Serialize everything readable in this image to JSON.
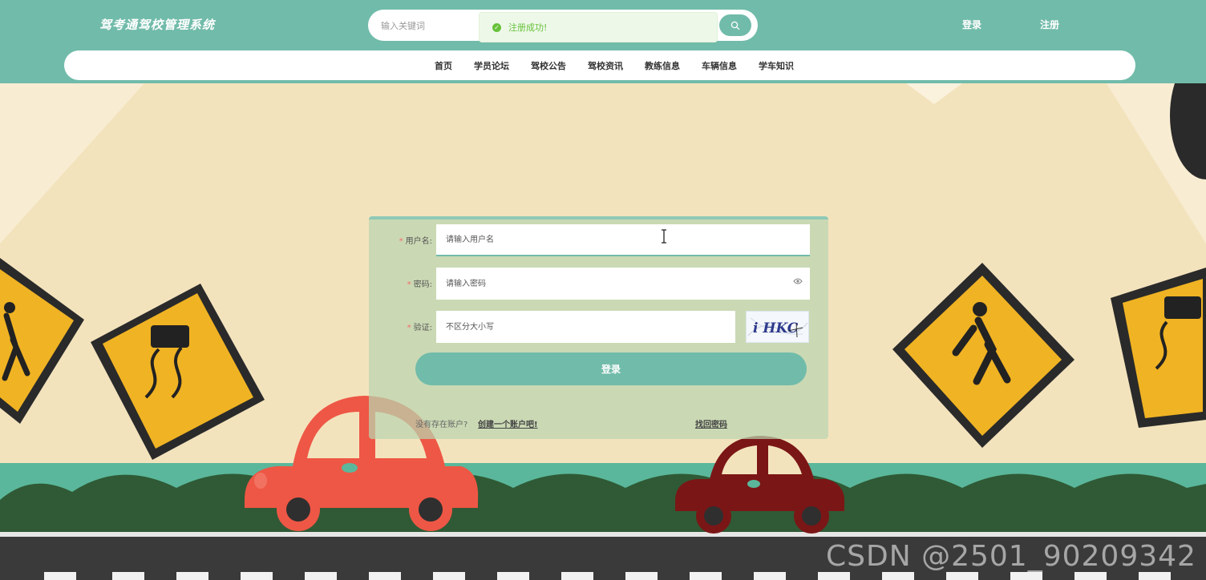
{
  "header": {
    "site_title": "驾考通驾校管理系统",
    "search_placeholder": "输入关键词",
    "login_label": "登录",
    "register_label": "注册"
  },
  "toast": {
    "message": "注册成功!",
    "type": "success"
  },
  "nav": {
    "items": [
      "首页",
      "学员论坛",
      "驾校公告",
      "驾校资讯",
      "教练信息",
      "车辆信息",
      "学车知识"
    ]
  },
  "login_form": {
    "username_label": "用户名:",
    "username_placeholder": "请输入用户名",
    "password_label": "密码:",
    "password_placeholder": "请输入密码",
    "captcha_label": "验证:",
    "captcha_placeholder": "不区分大小写",
    "captcha_text": "i HKC",
    "submit_label": "登录",
    "no_account_text": "没有存在账户?",
    "create_account_link": "创建一个账户吧!",
    "forgot_password_link": "找回密码"
  },
  "watermark": "CSDN @2501_90209342",
  "colors": {
    "primary": "#71bbaa",
    "background": "#f3e3bd",
    "success": "#67c23a",
    "required": "#f56c6c"
  }
}
